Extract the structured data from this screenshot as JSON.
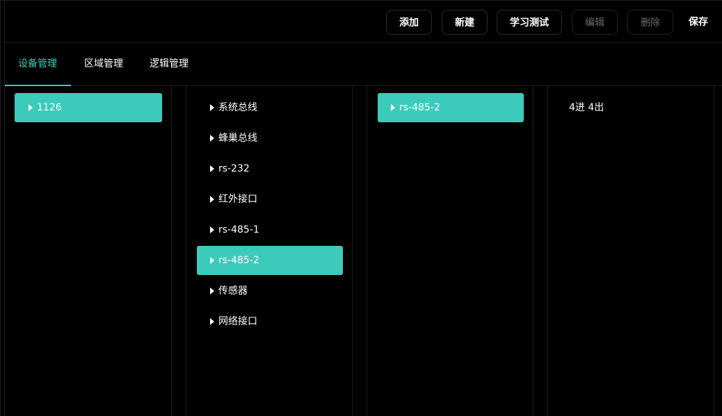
{
  "toolbar": {
    "buttons": [
      {
        "label": "添加",
        "disabled": false
      },
      {
        "label": "新建",
        "disabled": false
      },
      {
        "label": "学习测试",
        "disabled": false
      },
      {
        "label": "编辑",
        "disabled": true
      },
      {
        "label": "删除",
        "disabled": true
      }
    ],
    "save_label": "保存"
  },
  "tabs": [
    {
      "label": "设备管理",
      "active": true
    },
    {
      "label": "区域管理",
      "active": false
    },
    {
      "label": "逻辑管理",
      "active": false
    }
  ],
  "columns": {
    "devices": {
      "items": [
        {
          "label": "1126",
          "selected": true
        }
      ]
    },
    "interfaces": {
      "items": [
        {
          "label": "系统总线",
          "selected": false
        },
        {
          "label": "蜂巢总线",
          "selected": false
        },
        {
          "label": "rs-232",
          "selected": false
        },
        {
          "label": "红外接口",
          "selected": false
        },
        {
          "label": "rs-485-1",
          "selected": false
        },
        {
          "label": "rs-485-2",
          "selected": true
        },
        {
          "label": "传感器",
          "selected": false
        },
        {
          "label": "网络接口",
          "selected": false
        }
      ]
    },
    "channels": {
      "items": [
        {
          "label": "rs-485-2",
          "selected": true
        }
      ]
    },
    "details": {
      "text": "4进 4出"
    }
  },
  "colors": {
    "accent": "#3ccbbb",
    "background": "#000000",
    "disabled_text": "#6b6b6b"
  }
}
